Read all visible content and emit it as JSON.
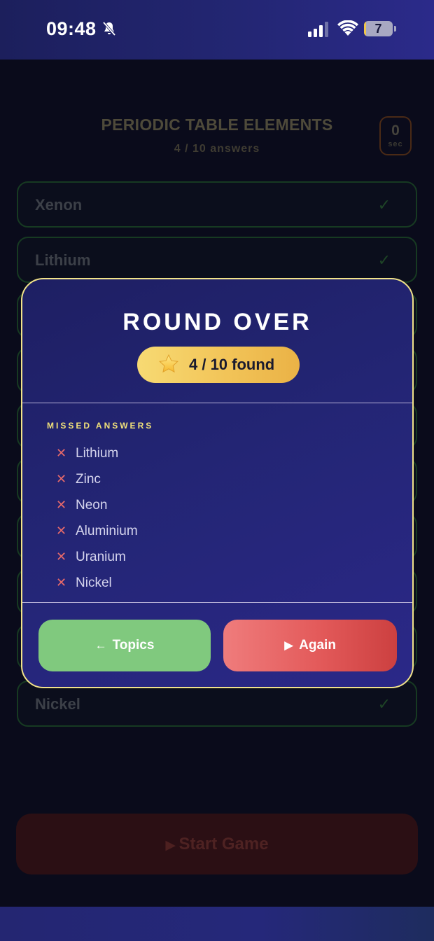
{
  "status_bar": {
    "time": "09:48",
    "battery_level": "7",
    "battery_fraction": 0.07,
    "icons": [
      "bell-slash-icon",
      "cellular-signal-icon",
      "wifi-icon",
      "battery-icon"
    ]
  },
  "game": {
    "title": "PERIODIC TABLE ELEMENTS",
    "subtitle": "4 / 10 answers",
    "timer": {
      "value": "0",
      "unit": "sec"
    },
    "answers": [
      {
        "label": "Xenon",
        "check": "✓"
      },
      {
        "label": "Lithium",
        "check": "✓"
      },
      {
        "label": "",
        "check": ""
      },
      {
        "label": "",
        "check": ""
      },
      {
        "label": "",
        "check": ""
      },
      {
        "label": "",
        "check": ""
      },
      {
        "label": "",
        "check": ""
      },
      {
        "label": "",
        "check": ""
      },
      {
        "label": "",
        "check": ""
      },
      {
        "label": "Nickel",
        "check": "✓"
      }
    ],
    "start_button": {
      "icon": "▶",
      "label": "Start Game"
    }
  },
  "modal": {
    "title": "ROUND OVER",
    "score_icon": "star-icon",
    "score_text": "4 / 10 found",
    "missed_heading": "MISSED ANSWERS",
    "missed_marker": "✕",
    "missed": [
      "Lithium",
      "Zinc",
      "Neon",
      "Aluminium",
      "Uranium",
      "Nickel"
    ],
    "buttons": {
      "topics": {
        "icon": "←",
        "label": "Topics"
      },
      "again": {
        "icon": "▶",
        "label": "Again"
      }
    }
  },
  "colors": {
    "accent_gold": "#f2c458",
    "border_gold": "#f1e28a",
    "topics_green": "#80c97e",
    "again_red": "#e35a5a",
    "modal_bg": "#232574"
  }
}
